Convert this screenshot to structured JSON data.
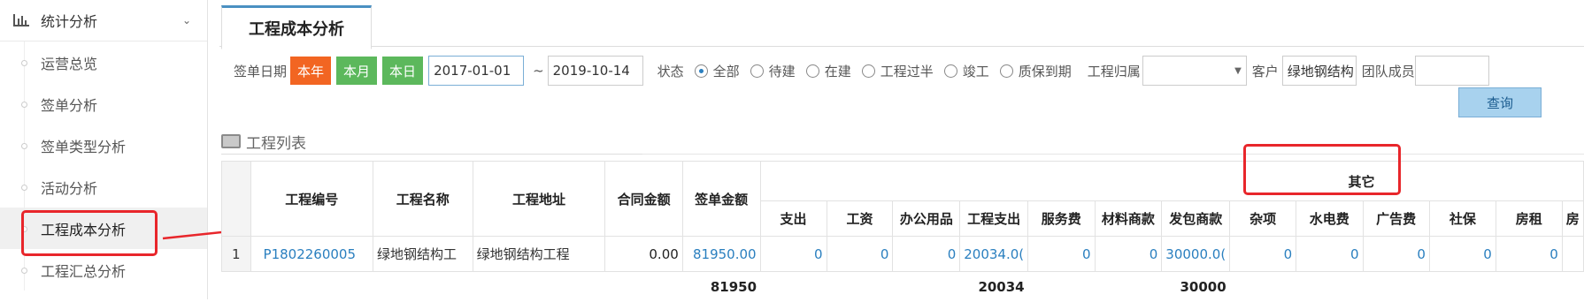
{
  "sidebar": {
    "header": "统计分析",
    "items": [
      {
        "label": "运营总览"
      },
      {
        "label": "签单分析"
      },
      {
        "label": "签单类型分析"
      },
      {
        "label": "活动分析"
      },
      {
        "label": "工程成本分析",
        "active": true
      },
      {
        "label": "工程汇总分析"
      }
    ]
  },
  "tab": {
    "title": "工程成本分析"
  },
  "filters": {
    "sign_date_label": "签单日期",
    "btn_year": "本年",
    "btn_month": "本月",
    "btn_day": "本日",
    "date_from": "2017-01-01",
    "tilde": "~",
    "date_to": "2019-10-14",
    "status_label": "状态",
    "status_options": [
      "全部",
      "待建",
      "在建",
      "工程过半",
      "竣工",
      "质保到期"
    ],
    "status_selected": "全部",
    "owner_label": "工程归属",
    "customer_label": "客户",
    "customer_value": "绿地钢结构",
    "team_label": "团队成员",
    "query": "查询"
  },
  "section": {
    "title": "工程列表"
  },
  "table": {
    "headers": {
      "code": "工程编号",
      "name": "工程名称",
      "address": "工程地址",
      "contract": "合同金额",
      "sign_amount": "签单金额",
      "other_group": "其它"
    },
    "subheaders": [
      "支出",
      "工资",
      "办公用品",
      "工程支出",
      "服务费",
      "材料商款",
      "发包商款",
      "杂项",
      "水电费",
      "广告费",
      "社保",
      "房租",
      "房"
    ],
    "rows": [
      {
        "index": "1",
        "code": "P1802260005",
        "name": "绿地钢结构工",
        "address": "绿地钢结构工程",
        "contract": "0.00",
        "sign_amount": "81950.00",
        "values": [
          "0",
          "0",
          "0",
          "20034.0(",
          "0",
          "0",
          "30000.0(",
          "0",
          "0",
          "0",
          "0",
          "0",
          ""
        ]
      }
    ],
    "totals": {
      "sign_amount": "81950",
      "project_expense": "20034",
      "contractor_payment": "30000"
    }
  },
  "colors": {
    "year": "#f26522",
    "month": "#5cb85c",
    "day": "#5cb85c",
    "highlight": "#e8262b",
    "link": "#2a7fbf"
  }
}
